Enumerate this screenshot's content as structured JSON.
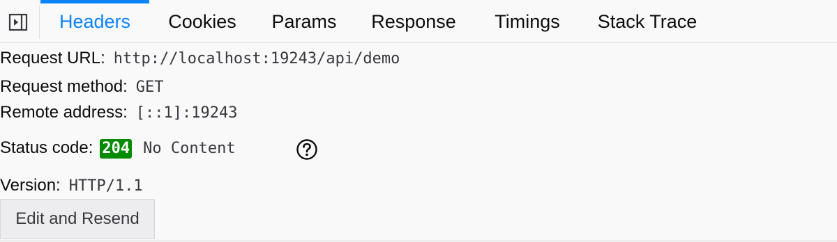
{
  "toolbar": {
    "toggle_icon": "sidebar-toggle-icon",
    "tabs": [
      "Headers",
      "Cookies",
      "Params",
      "Response",
      "Timings",
      "Stack Trace"
    ],
    "selected_tab": "Headers"
  },
  "summary": {
    "url_label": "Request URL:",
    "url_value": "http://localhost:19243/api/demo",
    "method_label": "Request method:",
    "method_value": "GET",
    "remote_label": "Remote address:",
    "remote_value": "[::1]:19243",
    "status_label": "Status code:",
    "status_code": "204",
    "status_text": "No Content",
    "help_icon": "question-circle-icon",
    "version_label": "Version:",
    "version_value": "HTTP/1.1"
  },
  "actions": {
    "resend_label": "Edit and Resend"
  },
  "colors": {
    "accent": "#0a84ff",
    "status_success": "#058b00"
  }
}
